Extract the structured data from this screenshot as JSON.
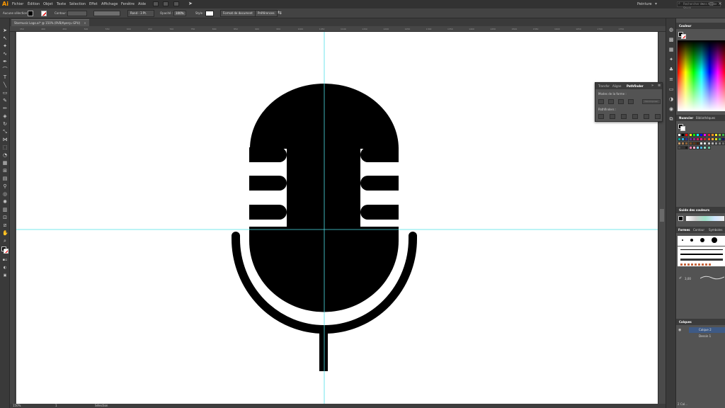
{
  "app": {
    "logo": "Ai",
    "workspace": "Peinture",
    "search_placeholder": "Rechercher dans Adobe Stock"
  },
  "menu": [
    "Fichier",
    "Édition",
    "Objet",
    "Texte",
    "Sélection",
    "Effet",
    "Affichage",
    "Fenêtre",
    "Aide"
  ],
  "control_bar": {
    "selection_label": "Aucune sélection",
    "stroke_label": "Contour :",
    "brush_label": "Rond - 3 Pt.",
    "opacity_label": "Opacité :",
    "opacity_value": "100%",
    "style_label": "Style :",
    "doc_format_button": "Format de document",
    "preferences_button": "Préférences"
  },
  "document_tab": {
    "title": "Starmusic Logo.ai* @ 150% (RVB/Aperçu GPU)"
  },
  "ruler_ticks": [
    "350",
    "400",
    "450",
    "500",
    "550",
    "600",
    "650",
    "700",
    "750",
    "800",
    "850",
    "900",
    "950",
    "1000",
    "1050",
    "1100",
    "1150",
    "1200",
    "1250",
    "1300",
    "1350",
    "1400",
    "1450",
    "1500",
    "1550",
    "1600",
    "1650",
    "1700",
    "1750"
  ],
  "status": {
    "zoom": "150%",
    "page": "1",
    "tool": "Sélection"
  },
  "pathfinder": {
    "tabs": [
      "Transfor",
      "Aligne",
      "Pathfinder"
    ],
    "active_tab": "Pathfinder",
    "shape_modes_label": "Modes de la forme :",
    "pathfinders_label": "Pathfinders :",
    "expand_button": "Décomposer"
  },
  "right_panel": {
    "color_tab": "Couleur",
    "swatches_tabs": [
      "Nuancier",
      "Bibliothèques"
    ],
    "color_guide_tab": "Guide des couleurs",
    "brushes_tabs": [
      "Formes",
      "Contour",
      "Symboles"
    ],
    "brush_size": "3,00",
    "layers_tab": "Calques",
    "layers": [
      "Calque 2",
      "Dessin 1"
    ],
    "layers_count": "2 Cal..."
  },
  "colors": {
    "guide_cyan": "#4ee0e8",
    "selection_blue": "#3e5a85",
    "ai_orange": "#ff9a00"
  }
}
